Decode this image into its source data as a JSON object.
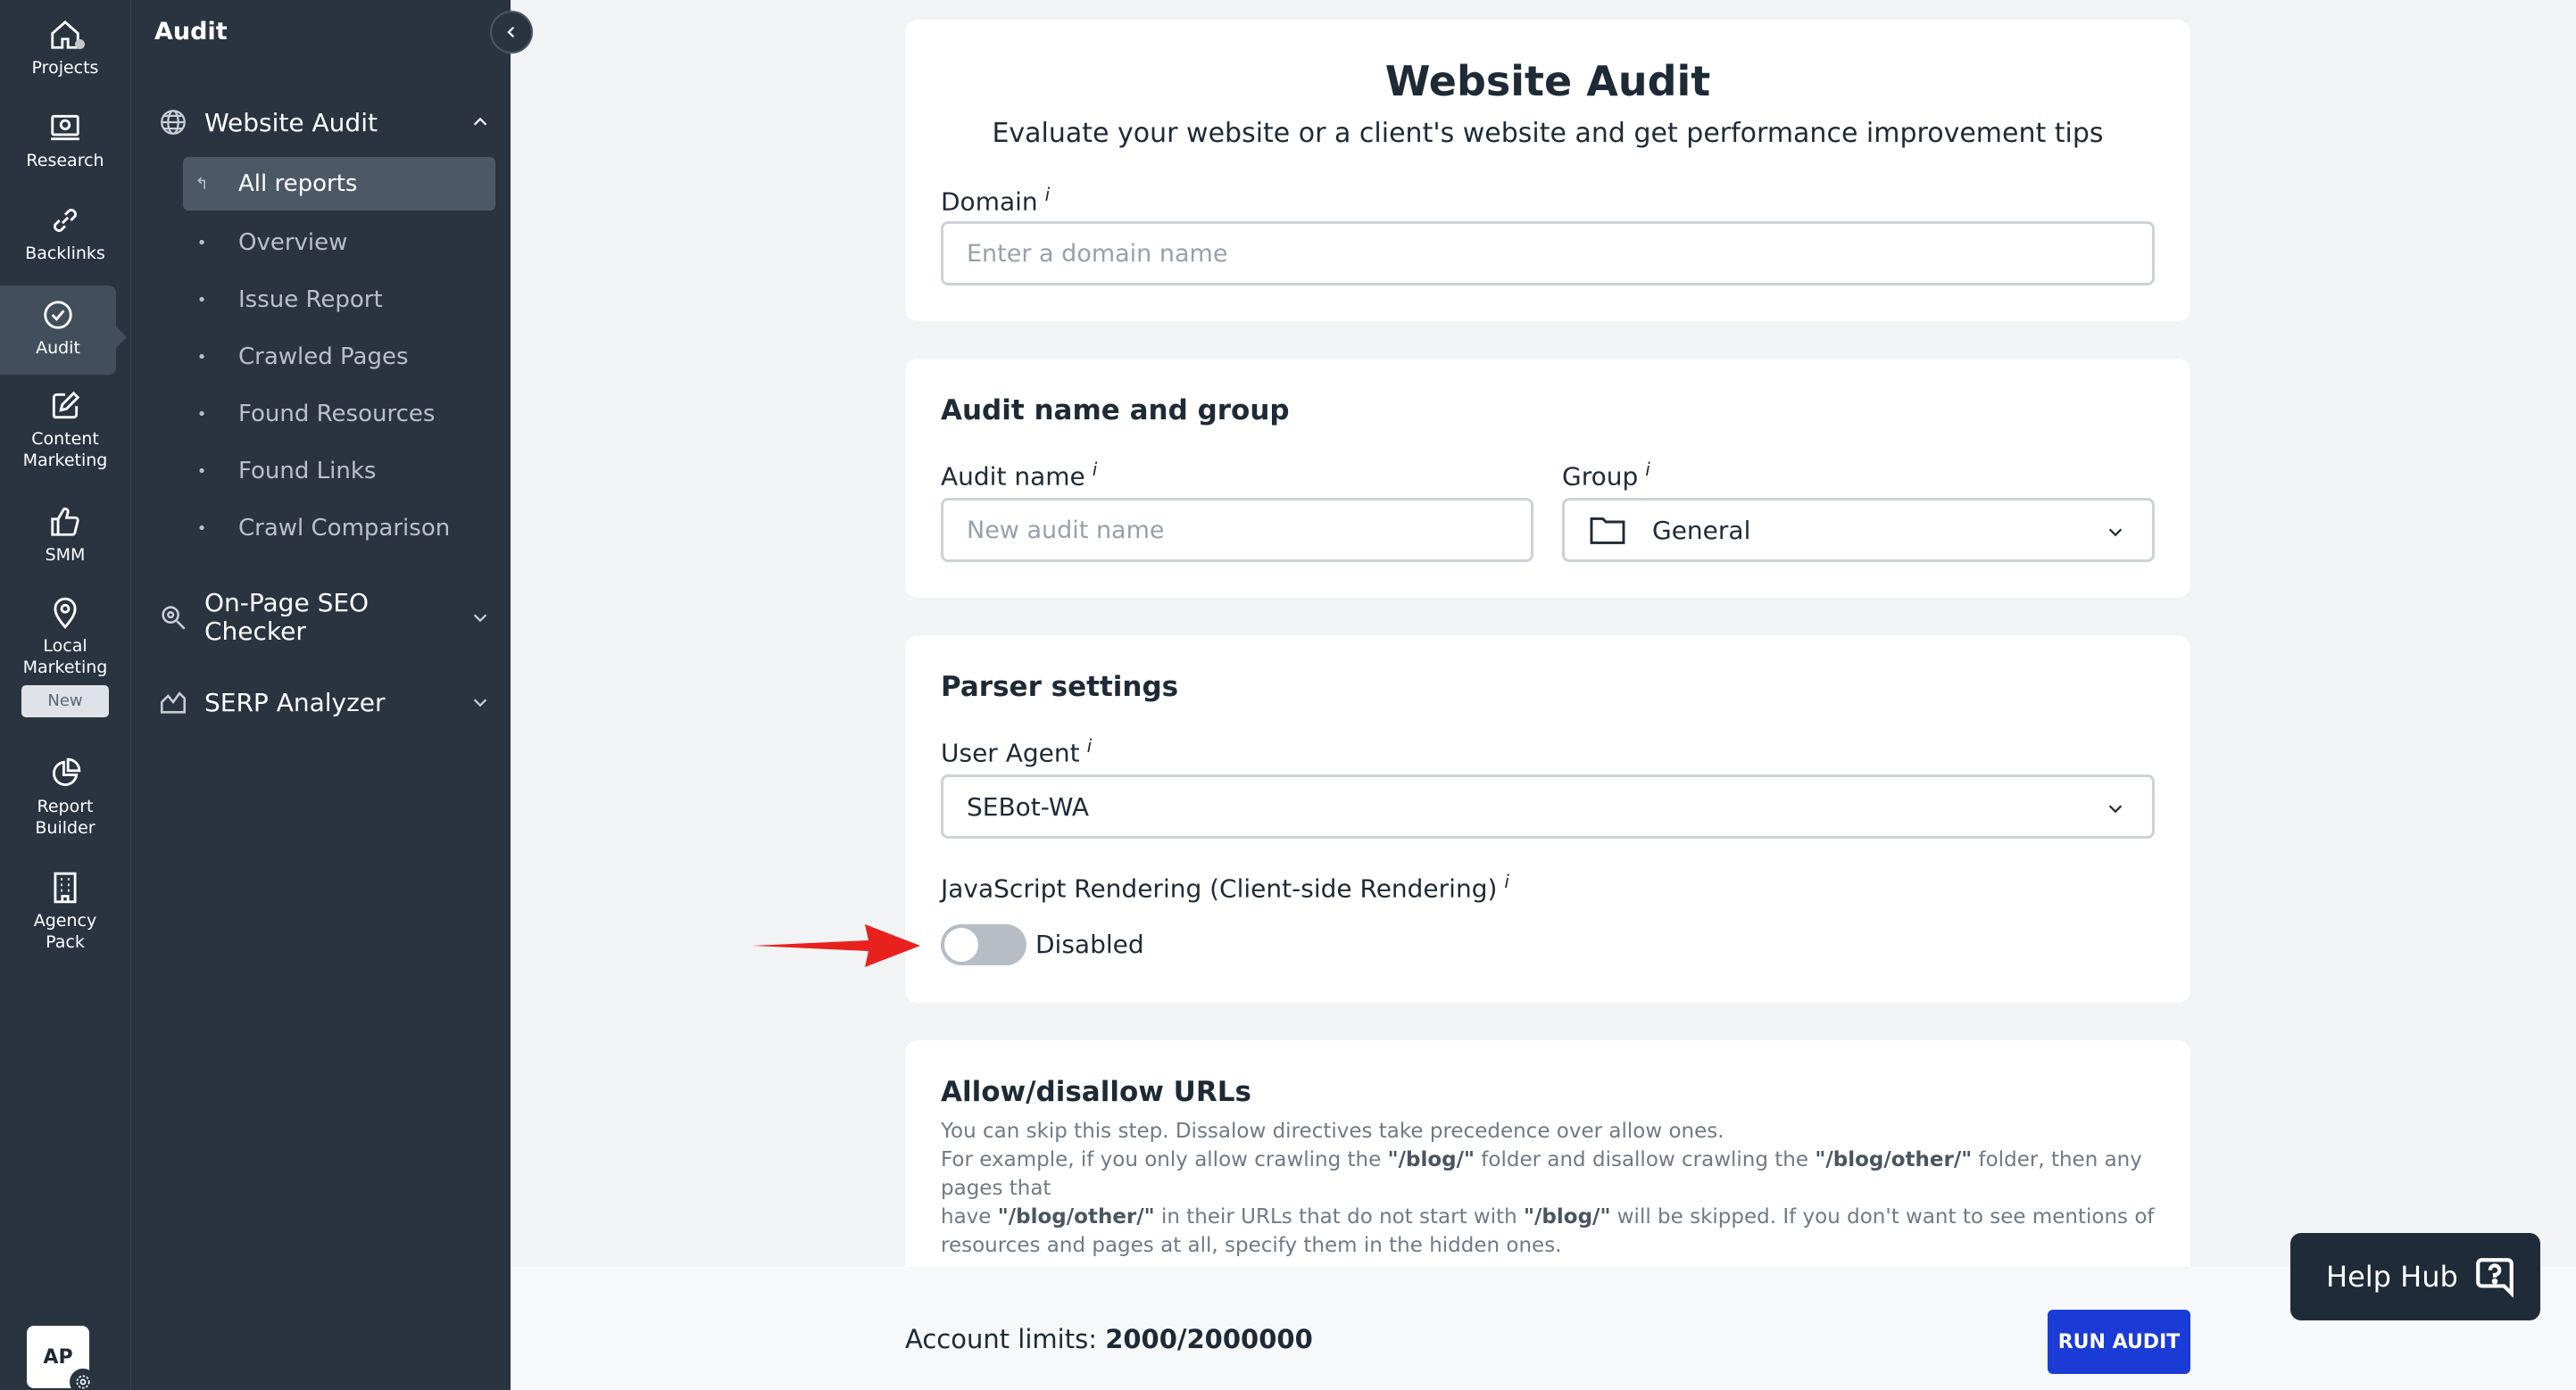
{
  "rail": {
    "items": [
      {
        "label": "Projects",
        "icon": "home-icon"
      },
      {
        "label": "Research",
        "icon": "research-icon"
      },
      {
        "label": "Backlinks",
        "icon": "link-icon"
      },
      {
        "label": "Audit",
        "icon": "check-circle-icon"
      },
      {
        "label": "Content Marketing",
        "icon": "edit-icon"
      },
      {
        "label": "SMM",
        "icon": "thumbs-up-icon"
      },
      {
        "label": "Local Marketing",
        "icon": "map-pin-icon"
      },
      {
        "label": "Report Builder",
        "icon": "pie-chart-icon"
      },
      {
        "label": "Agency Pack",
        "icon": "building-icon"
      }
    ],
    "new_badge": "New",
    "avatar": "AP"
  },
  "sidebar": {
    "title": "Audit",
    "website_audit": {
      "label": "Website Audit",
      "items": [
        "All reports",
        "Overview",
        "Issue Report",
        "Crawled Pages",
        "Found Resources",
        "Found Links",
        "Crawl Comparison"
      ]
    },
    "onpage": {
      "label_line1": "On-Page SEO",
      "label_line2": "Checker"
    },
    "serp": {
      "label": "SERP Analyzer"
    }
  },
  "main": {
    "title": "Website Audit",
    "subtitle": "Evaluate your website or a client's website and get performance improvement tips",
    "domain_label": "Domain",
    "info_mark": "i",
    "domain_placeholder": "Enter a domain name",
    "audit_section_title": "Audit name and group",
    "audit_name_label": "Audit name",
    "audit_name_placeholder": "New audit name",
    "group_label": "Group",
    "group_value": "General",
    "parser_title": "Parser settings",
    "user_agent_label": "User Agent",
    "user_agent_value": "SEBot-WA",
    "js_label": "JavaScript Rendering (Client-side Rendering)",
    "js_state": "Disabled",
    "allow_title": "Allow/disallow URLs",
    "allow_desc_1": "You can skip this step. Dissalow directives take precedence over allow ones.",
    "allow_desc_2a": "For example, if you only allow crawling the ",
    "allow_desc_2b": "\"/blog/\"",
    "allow_desc_2c": " folder and disallow crawling the ",
    "allow_desc_2d": "\"/blog/other/\"",
    "allow_desc_2e": " folder, then any pages that",
    "allow_desc_3a": "have ",
    "allow_desc_3b": "\"/blog/other/\"",
    "allow_desc_3c": " in their URLs that do not start with ",
    "allow_desc_3d": "\"/blog/\"",
    "allow_desc_3e": " will be skipped. If you don't want to see mentions of",
    "allow_desc_4": "resources and pages at all, specify them in the hidden ones."
  },
  "footer": {
    "limits_label": "Account limits:",
    "limits_value": "2000/2000000",
    "run_button": "RUN AUDIT"
  },
  "help": {
    "label": "Help Hub"
  },
  "colors": {
    "accent": "#1a3bd6",
    "sidebar": "#2a3441",
    "annotation_arrow": "#e8211e"
  }
}
